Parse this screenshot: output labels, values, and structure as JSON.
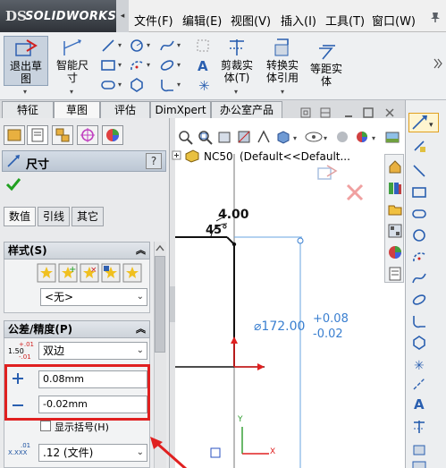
{
  "app": {
    "logo_text": "SOLIDWORKS",
    "logo_symbol": "DS",
    "collapse_arrow": "◂"
  },
  "menu": {
    "items": [
      {
        "label": "文件(F)"
      },
      {
        "label": "编辑(E)"
      },
      {
        "label": "视图(V)"
      },
      {
        "label": "插入(I)"
      },
      {
        "label": "工具(T)"
      },
      {
        "label": "窗口(W)"
      }
    ],
    "pin_icon": "pin-icon"
  },
  "ribbon": {
    "buttons": [
      {
        "label_line1": "退出草",
        "label_line2": "图",
        "icon": "exit-sketch-icon"
      },
      {
        "label_line1": "智能尺",
        "label_line2": "寸",
        "icon": "smart-dimension-icon"
      },
      {
        "label_line1": "剪裁实",
        "label_line2": "体(T)",
        "icon": "trim-entities-icon"
      },
      {
        "label_line1": "转换实",
        "label_line2": "体引用",
        "icon": "convert-entities-icon"
      },
      {
        "label_line1": "等距实",
        "label_line2": "体",
        "icon": "offset-entities-icon"
      }
    ],
    "more_icon": "chevron-right-icon"
  },
  "tabs": [
    {
      "label": "特征"
    },
    {
      "label": "草图",
      "active": true
    },
    {
      "label": "评估"
    },
    {
      "label": "DimXpert"
    },
    {
      "label": "办公室产品"
    }
  ],
  "property_manager": {
    "title": "尺寸",
    "help": "?",
    "ok_icon": "checkmark-icon",
    "subtabs": [
      {
        "label": "数值",
        "active": true
      },
      {
        "label": "引线"
      },
      {
        "label": "其它"
      }
    ],
    "style_group": {
      "title": "样式(S)",
      "combo_value": "<无>"
    },
    "tolerance_group": {
      "title": "公差/精度(P)",
      "type_value": "双边",
      "upper_value": "0.08mm",
      "lower_value": "-0.02mm",
      "parentheses_label": "显示括号(H)",
      "precision_value": ".12 (文件)",
      "tol_icon_text": "1.50",
      "prec_icon_text": "X.XXX"
    }
  },
  "graphics": {
    "tree_label": "NC50",
    "tree_config": "(Default<<Default...",
    "dim_chamfer_length": "4.00",
    "dim_chamfer_angle": "45°",
    "dim_diameter": "⌀172.00",
    "tol_upper": "+0.08",
    "tol_lower": "-0.02",
    "axis_y": "Y",
    "axis_x": "X",
    "colors": {
      "dimension_blue": "#3a7fd0",
      "annotation_red": "#e02020",
      "axis_red": "#e02020",
      "axis_green": "#2a9a2a"
    }
  }
}
